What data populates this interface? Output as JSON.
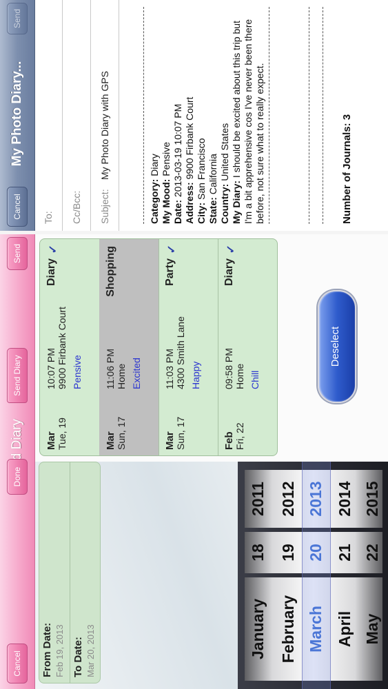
{
  "send_screen": {
    "cancel_label": "Cancel",
    "title": "Send Diary",
    "done_label": "Done",
    "send_diary_label": "Send Diary",
    "send_label": "Send",
    "from_label": "From Date:",
    "from_value": "Feb 19, 2013",
    "to_label": "To Date:",
    "to_value": "Mar 20, 2013",
    "picker": {
      "months": [
        "January",
        "February",
        "March",
        "April",
        "May"
      ],
      "days": [
        "18",
        "19",
        "20",
        "21",
        "22"
      ],
      "years": [
        "2011",
        "2012",
        "2013",
        "2014",
        "2015"
      ],
      "selected_index": 2
    },
    "journals": [
      {
        "month": "Mar",
        "day": "Tue, 19",
        "time": "10:07 PM",
        "address": "9900 Firbank Court",
        "mood": "Pensive",
        "category": "Diary",
        "checked": "✓"
      },
      {
        "month": "Mar",
        "day": "Sun, 17",
        "time": "11:06 PM",
        "address": "Home",
        "mood": "Excited",
        "category": "Shopping",
        "checked": ""
      },
      {
        "month": "Mar",
        "day": "Sun, 17",
        "time": "11:03 PM",
        "address": "4300 Smith Lane",
        "mood": "Happy",
        "category": "Party",
        "checked": "✓"
      },
      {
        "month": "Feb",
        "day": "Fri, 22",
        "time": "09:58 PM",
        "address": "Home",
        "mood": "Chill",
        "category": "Diary",
        "checked": "✓"
      }
    ],
    "deselect_label": "Deselect"
  },
  "mail": {
    "cancel_label": "Cancel",
    "title": "My Photo Diary...",
    "send_label": "Send",
    "to_label": "To:",
    "cc_label": "Cc/Bcc:",
    "subject_label": "Subject:",
    "subject_value": "My Photo Diary with GPS",
    "body": {
      "category_label": "Category:",
      "category": " Diary",
      "mood_label": "My Mood:",
      "mood": " Pensive",
      "date_label": "Date:",
      "date": " 2013-03-19 10:07 PM",
      "address_label": "Address:",
      "address": " 9900 Firbank Court",
      "city_label": "City:",
      "city": " San Francisco",
      "state_label": "State:",
      "state": " California",
      "country_label": "Country:",
      "country": " United States",
      "diary_label": "My Diary:",
      "diary": " I should be excited about this trip but I'm a bit apprehensive cos I've never been there before, not sure what to really expect."
    },
    "journal_count": "Number of Journals: 3"
  }
}
